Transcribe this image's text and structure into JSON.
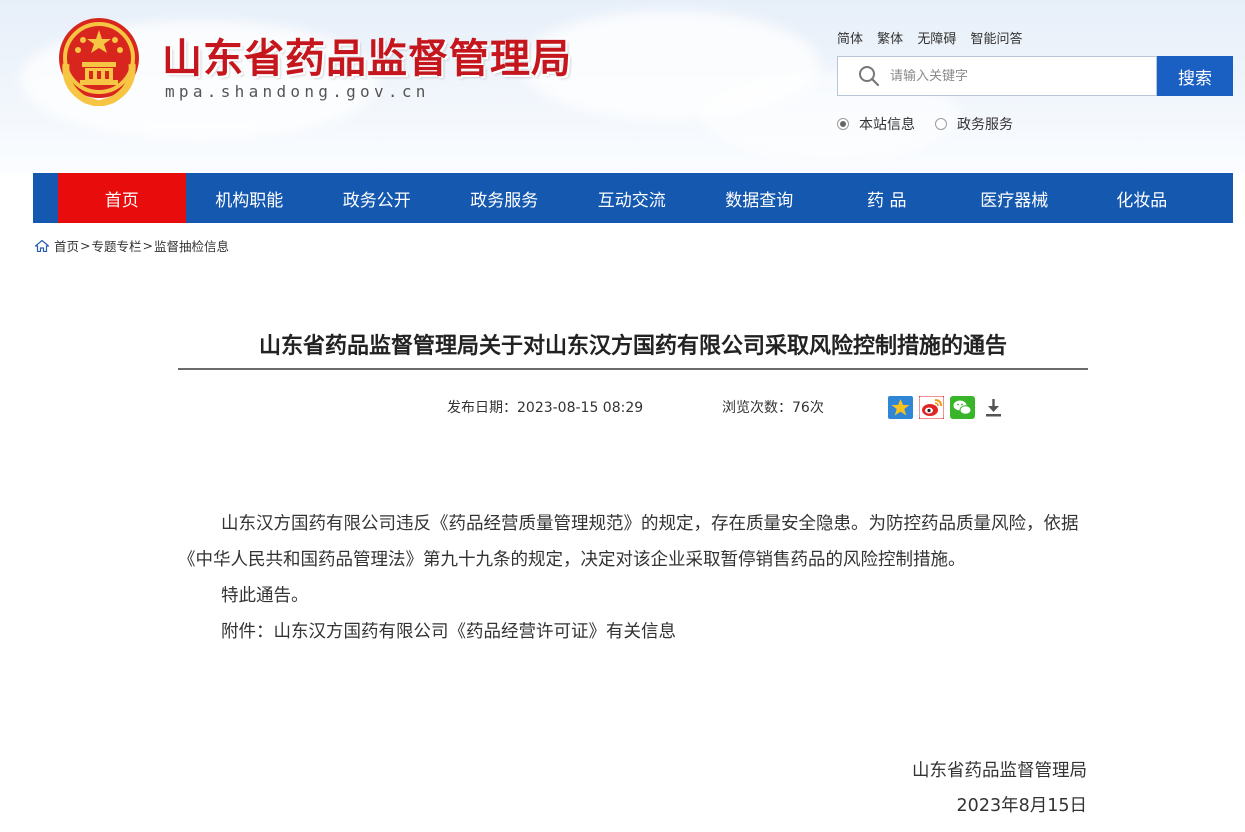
{
  "header": {
    "site_title": "山东省药品监督管理局",
    "domain": "mpa.shandong.gov.cn",
    "lang_links": [
      "简体",
      "繁体",
      "无障碍",
      "智能问答"
    ],
    "search": {
      "placeholder": "请输入关键字",
      "button_label": "搜索"
    },
    "scope_options": [
      {
        "label": "本站信息",
        "checked": true
      },
      {
        "label": "政务服务",
        "checked": false
      }
    ]
  },
  "nav": {
    "items": [
      "首页",
      "机构职能",
      "政务公开",
      "政务服务",
      "互动交流",
      "数据查询",
      "药 品",
      "医疗器械",
      "化妆品"
    ],
    "active_index": 0
  },
  "breadcrumb": {
    "items": [
      "首页",
      "专题专栏",
      "监督抽检信息"
    ],
    "separator": ">"
  },
  "article": {
    "title": "山东省药品监督管理局关于对山东汉方国药有限公司采取风险控制措施的通告",
    "publish_label": "发布日期：",
    "publish_date": "2023-08-15 08:29",
    "views_label": "浏览次数：",
    "views": "76次",
    "paragraphs": [
      "山东汉方国药有限公司违反《药品经营质量管理规范》的规定，存在质量安全隐患。为防控药品质量风险，依据《中华人民共和国药品管理法》第九十九条的规定，决定对该企业采取暂停销售药品的风险控制措施。",
      "特此通告。",
      "附件：山东汉方国药有限公司《药品经营许可证》有关信息"
    ],
    "signature_org": "山东省药品监督管理局",
    "signature_date": "2023年8月15日"
  },
  "colors": {
    "brand_red": "#c4161c",
    "nav_blue": "#1558b0",
    "nav_active": "#e90c0c",
    "search_button": "#1a5fc2"
  },
  "icons": {
    "emblem": "national-emblem-icon",
    "search": "search-icon",
    "home": "home-icon",
    "share": [
      "favorite-star-icon",
      "weibo-icon",
      "wechat-icon",
      "download-icon"
    ]
  }
}
